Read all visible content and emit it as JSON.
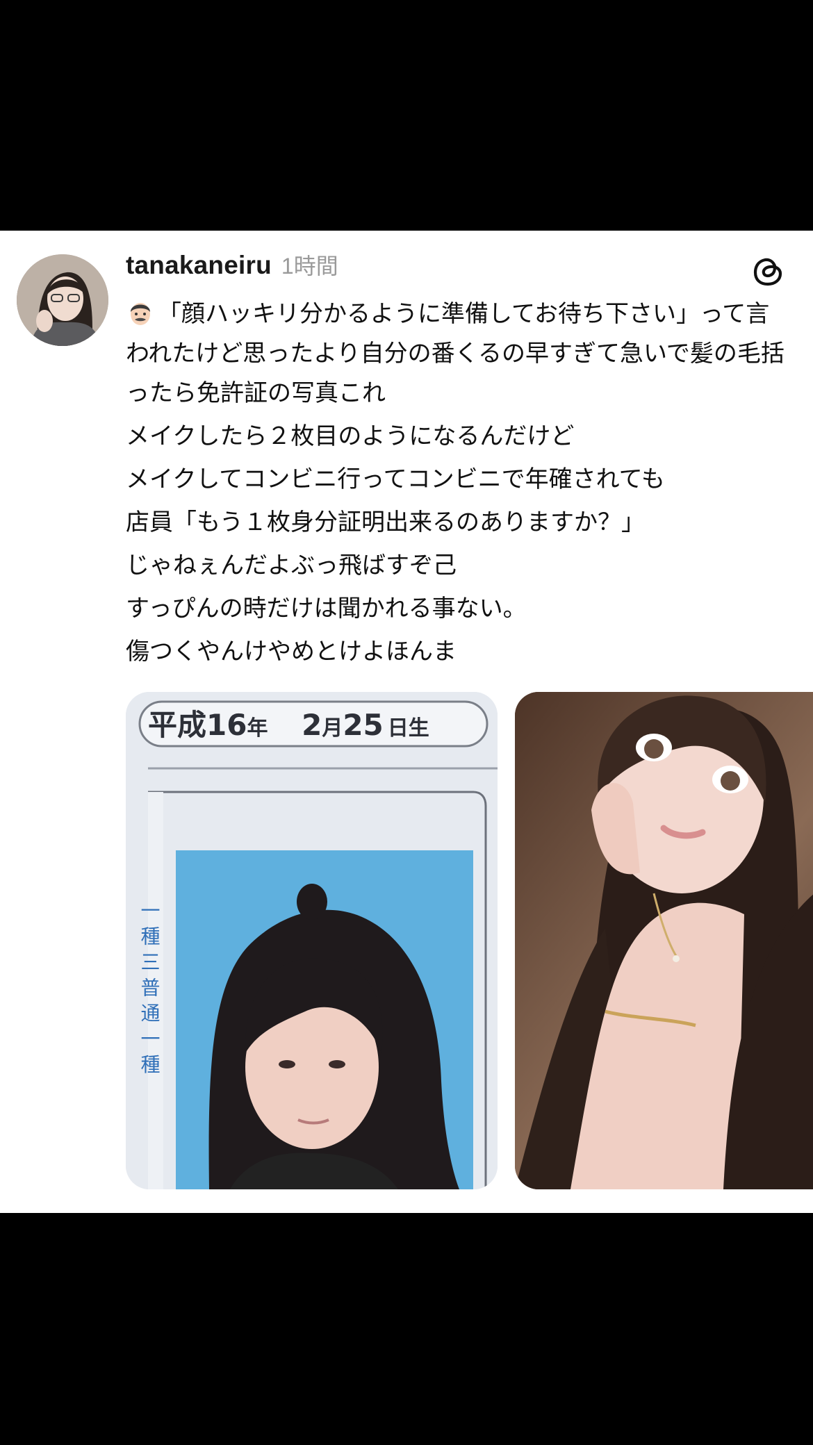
{
  "post": {
    "username": "tanakaneiru",
    "timestamp": "1時間",
    "emoji_icon": "man-face-emoji-icon",
    "lines": [
      "「顔ハッキリ分かるように準備してお待ち下さい」って言われたけど思ったより自分の番くるの早すぎて急いで髪の毛括ったら免許証の写真これ",
      "メイクしたら２枚目のようになるんだけど",
      "メイクしてコンビニ行ってコンビニで年確されても",
      "店員「もう１枚身分証明出来るのありますか？」",
      "じゃねぇんだよぶっ飛ばすぞ己",
      "すっぴんの時だけは聞かれる事ない。",
      "傷つくやんけやめとけよほんま"
    ]
  },
  "images": {
    "id_card": {
      "birth_era": "平成",
      "birth_year": "16",
      "year_unit": "年",
      "birth_month": "2",
      "month_unit": "月",
      "birth_day": "25",
      "day_suffix": "日生",
      "side_text": "一 種 三 普 通 一 種"
    }
  },
  "icons": {
    "header_right": "threads-logo-icon"
  },
  "colors": {
    "background": "#000000",
    "card": "#ffffff",
    "username": "#1a1a1a",
    "timestamp": "#9a9a9a",
    "id_photo_bg": "#5fb0de"
  }
}
